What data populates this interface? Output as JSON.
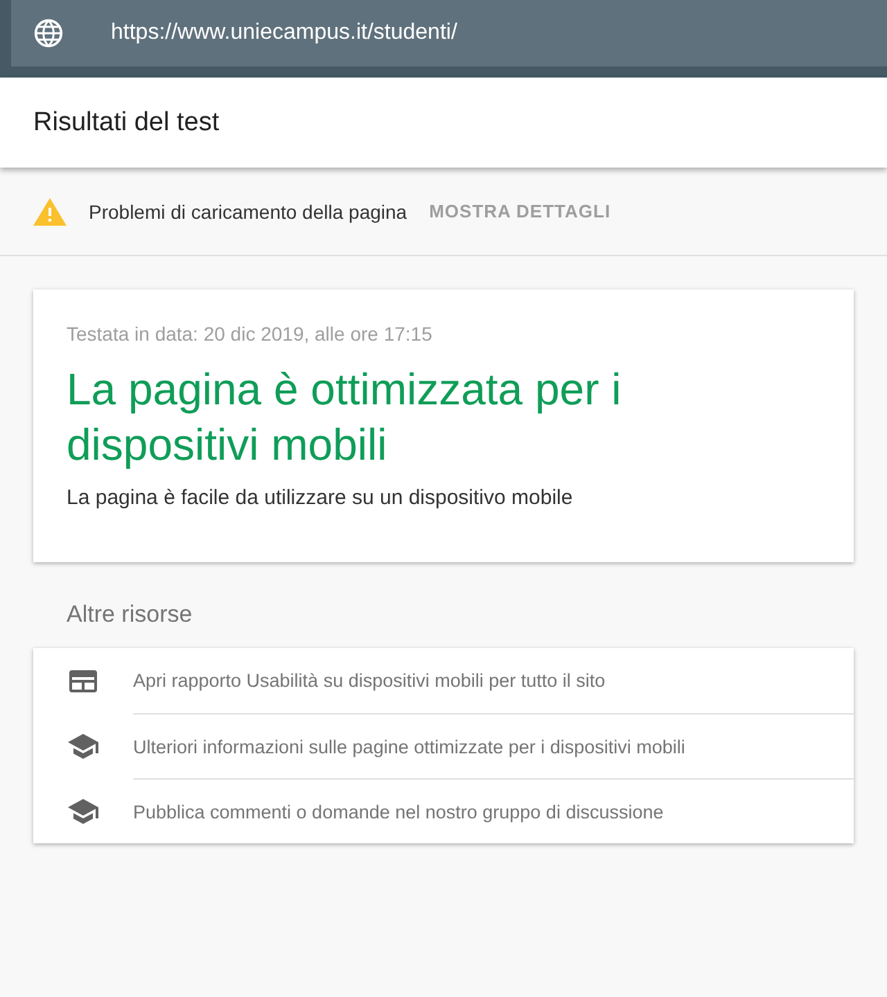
{
  "address_bar": {
    "url": "https://www.uniecampus.it/studenti/"
  },
  "header": {
    "title": "Risultati del test"
  },
  "warning": {
    "message": "Problemi di caricamento della pagina",
    "action": "MOSTRA DETTAGLI"
  },
  "result": {
    "tested_on": "Testata in data: 20 dic 2019, alle ore 17:15",
    "verdict": "La pagina è ottimizzata per i dispositivi mobili",
    "description": "La pagina è facile da utilizzare su un dispositivo mobile"
  },
  "resources": {
    "title": "Altre risorse",
    "items": [
      {
        "kind": "report",
        "label": "Apri rapporto Usabilità su dispositivi mobili per tutto il sito"
      },
      {
        "kind": "learn",
        "label": "Ulteriori informazioni sulle pagine ottimizzate per i dispositivi mobili"
      },
      {
        "kind": "learn",
        "label": "Pubblica commenti o domande nel nostro gruppo di discussione"
      }
    ]
  }
}
